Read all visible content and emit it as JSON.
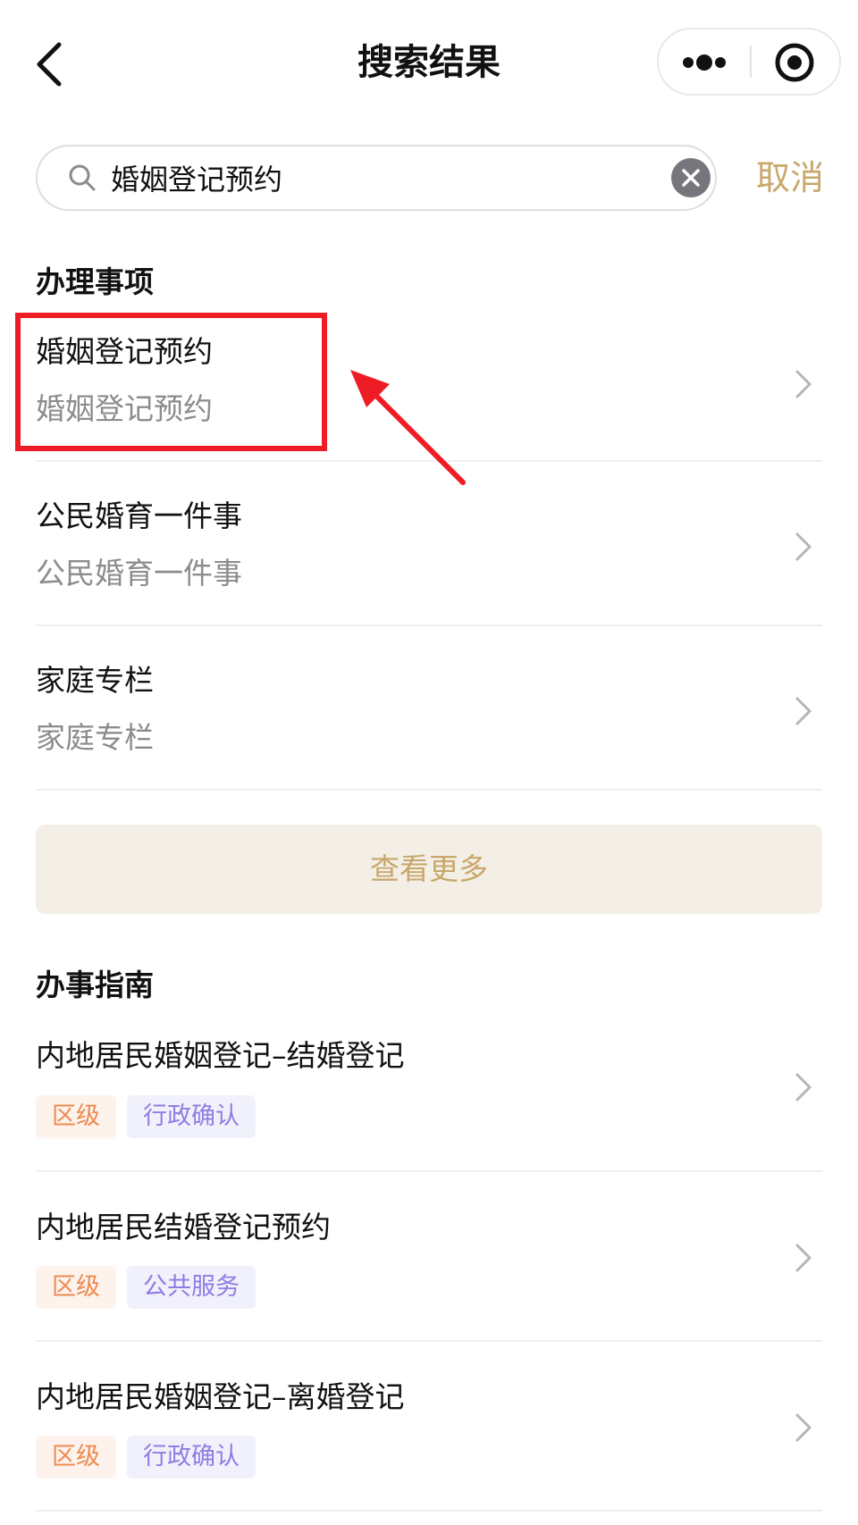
{
  "nav": {
    "title": "搜索结果",
    "back_icon": "chevron-left-icon",
    "more_icon": "more-dots-icon",
    "close_icon": "target-close-icon"
  },
  "search": {
    "value": "婚姻登记预约",
    "placeholder": "",
    "cancel_label": "取消",
    "search_icon": "search-icon",
    "clear_icon": "clear-icon"
  },
  "sections": {
    "matters": {
      "title": "办理事项",
      "items": [
        {
          "title": "婚姻登记预约",
          "subtitle": "婚姻登记预约"
        },
        {
          "title": "公民婚育一件事",
          "subtitle": "公民婚育一件事"
        },
        {
          "title": "家庭专栏",
          "subtitle": "家庭专栏"
        }
      ],
      "more_label": "查看更多"
    },
    "guides": {
      "title": "办事指南",
      "items": [
        {
          "title": "内地居民婚姻登记–结婚登记",
          "tags": [
            "区级",
            "行政确认"
          ]
        },
        {
          "title": "内地居民结婚登记预约",
          "tags": [
            "区级",
            "公共服务"
          ]
        },
        {
          "title": "内地居民婚姻登记–离婚登记",
          "tags": [
            "区级",
            "行政确认"
          ]
        }
      ]
    }
  },
  "colors": {
    "accent": "#c8a86b",
    "more_bg": "#f4efe6",
    "tag_level_text": "#ee8a51",
    "tag_level_bg": "#fdf3ec",
    "tag_type_text": "#8f7de3",
    "tag_type_bg": "#f1f1fb",
    "annotation": "#ee1c25"
  }
}
